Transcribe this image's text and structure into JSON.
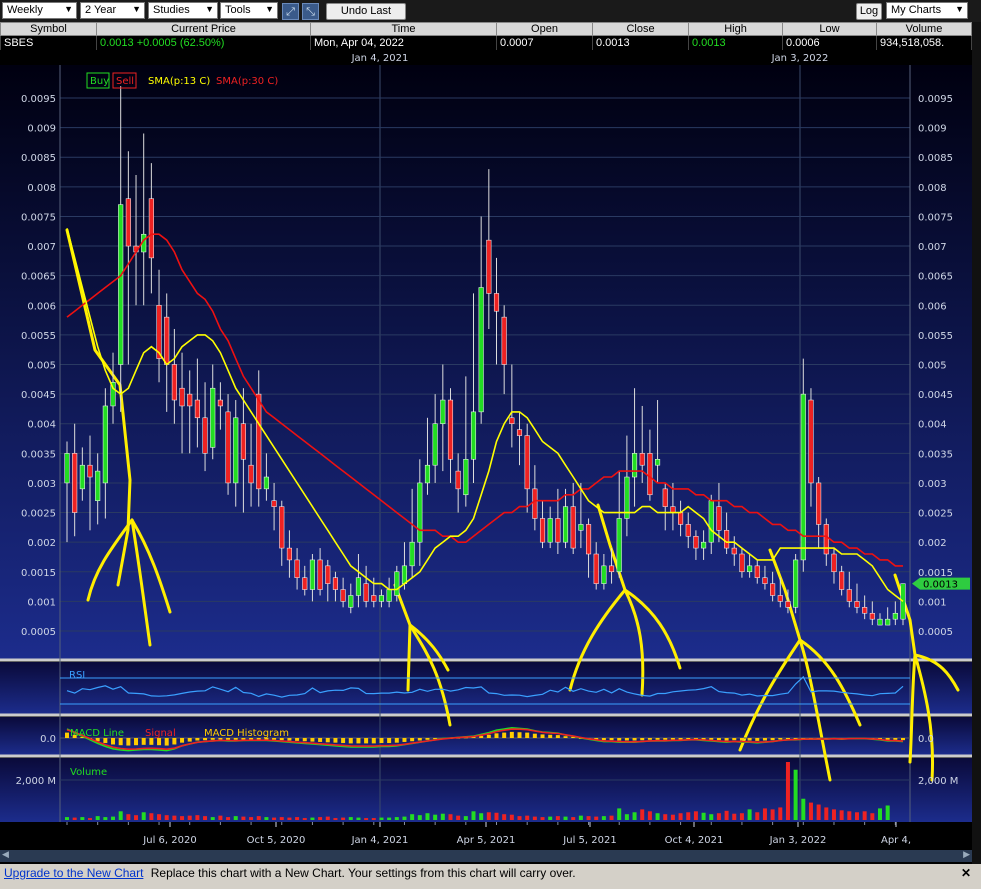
{
  "toolbar": {
    "interval": "Weekly",
    "range": "2 Year",
    "studies": "Studies",
    "tools": "Tools",
    "undo_label": "Undo Last",
    "log_label": "Log",
    "mycharts": "My Charts"
  },
  "quote": {
    "headers": [
      "Symbol",
      "Current Price",
      "Time",
      "Open",
      "Close",
      "High",
      "Low",
      "Volume"
    ],
    "symbol": "SBES",
    "current_price": "0.0013 +0.0005 (62.50%)",
    "time": "Mon, Apr 04, 2022",
    "open": "0.0007",
    "close": "0.0013",
    "high": "0.0013",
    "low": "0.0006",
    "volume": "934,518,058."
  },
  "status": {
    "link": "Upgrade to the New Chart",
    "message": "Replace this chart with a New Chart. Your settings from this chart will carry over."
  },
  "chart_data": {
    "type": "candlestick",
    "top_dates": [
      "Jan 4, 2021",
      "Jan 3, 2022"
    ],
    "x_labels": [
      "Jul 6, 2020",
      "Oct 5, 2020",
      "Jan 4, 2021",
      "Apr 5, 2021",
      "Jul 5, 2021",
      "Oct 4, 2021",
      "Jan 3, 2022",
      "Apr 4,"
    ],
    "y_ticks": [
      "0.0005",
      "0.001",
      "0.0015",
      "0.002",
      "0.0025",
      "0.003",
      "0.0035",
      "0.004",
      "0.0045",
      "0.005",
      "0.0055",
      "0.006",
      "0.0065",
      "0.007",
      "0.0075",
      "0.008",
      "0.0085",
      "0.009",
      "0.0095"
    ],
    "ylim": [
      0.0002,
      0.01
    ],
    "last_price_label": "0.0013",
    "legend": {
      "buy": "Buy",
      "sell": "Sell",
      "sma13": "SMA(p:13 C)",
      "sma30": "SMA(p:30 C)"
    },
    "colors": {
      "up": "#22dd22",
      "down": "#ee2222",
      "sma13": "#ffff00",
      "sma30": "#ee1111",
      "bg_top": "#000010",
      "bg_bottom": "#1c2c8c",
      "annotation": "#ffee00",
      "rsi": "#3aa0ff",
      "macd": "#22dd22",
      "signal": "#ee2222",
      "hist": "#ffcc00"
    },
    "candles": [
      [
        0.003,
        0.0035,
        0.0037,
        0.002
      ],
      [
        0.0035,
        0.0025,
        0.004,
        0.0021
      ],
      [
        0.0029,
        0.0033,
        0.0036,
        0.0027
      ],
      [
        0.0033,
        0.0031,
        0.0038,
        0.0022
      ],
      [
        0.0027,
        0.0032,
        0.0035,
        0.0023
      ],
      [
        0.003,
        0.0043,
        0.0046,
        0.0024
      ],
      [
        0.0043,
        0.0047,
        0.0052,
        0.004
      ],
      [
        0.005,
        0.0077,
        0.0097,
        0.0042
      ],
      [
        0.0078,
        0.007,
        0.0086,
        0.005
      ],
      [
        0.007,
        0.0069,
        0.0082,
        0.006
      ],
      [
        0.0069,
        0.0072,
        0.0089,
        0.006
      ],
      [
        0.0078,
        0.0068,
        0.0084,
        0.0062
      ],
      [
        0.006,
        0.0051,
        0.0066,
        0.0047
      ],
      [
        0.0058,
        0.005,
        0.0062,
        0.0042
      ],
      [
        0.005,
        0.0044,
        0.0056,
        0.004
      ],
      [
        0.0046,
        0.0043,
        0.0052,
        0.0035
      ],
      [
        0.0045,
        0.0043,
        0.0049,
        0.0035
      ],
      [
        0.0044,
        0.0041,
        0.0051,
        0.0036
      ],
      [
        0.0041,
        0.0035,
        0.0047,
        0.0032
      ],
      [
        0.0036,
        0.0046,
        0.005,
        0.0034
      ],
      [
        0.0044,
        0.0043,
        0.0047,
        0.0039
      ],
      [
        0.0042,
        0.003,
        0.0045,
        0.0028
      ],
      [
        0.003,
        0.0041,
        0.0044,
        0.0026
      ],
      [
        0.004,
        0.0034,
        0.0046,
        0.0025
      ],
      [
        0.0033,
        0.003,
        0.004,
        0.0026
      ],
      [
        0.0045,
        0.0029,
        0.0049,
        0.0026
      ],
      [
        0.0029,
        0.0031,
        0.0035,
        0.0027
      ],
      [
        0.0027,
        0.0026,
        0.003,
        0.0022
      ],
      [
        0.0026,
        0.0019,
        0.0027,
        0.0016
      ],
      [
        0.0019,
        0.0017,
        0.0022,
        0.0014
      ],
      [
        0.0017,
        0.0014,
        0.0019,
        0.0012
      ],
      [
        0.0014,
        0.0012,
        0.0016,
        0.0011
      ],
      [
        0.0012,
        0.0017,
        0.0018,
        0.001
      ],
      [
        0.0017,
        0.0012,
        0.0019,
        0.0011
      ],
      [
        0.0016,
        0.0013,
        0.0017,
        0.001
      ],
      [
        0.0014,
        0.0012,
        0.0015,
        0.001
      ],
      [
        0.0012,
        0.001,
        0.0014,
        0.0009
      ],
      [
        0.0009,
        0.0011,
        0.0013,
        0.0008
      ],
      [
        0.0011,
        0.0014,
        0.0018,
        0.0009
      ],
      [
        0.0013,
        0.001,
        0.0016,
        0.0009
      ],
      [
        0.0011,
        0.001,
        0.0014,
        0.0009
      ],
      [
        0.001,
        0.0011,
        0.0012,
        0.0009
      ],
      [
        0.001,
        0.0012,
        0.0014,
        0.0009
      ],
      [
        0.0011,
        0.0015,
        0.0016,
        0.001
      ],
      [
        0.0013,
        0.0016,
        0.002,
        0.0012
      ],
      [
        0.0016,
        0.002,
        0.0029,
        0.0014
      ],
      [
        0.002,
        0.003,
        0.0034,
        0.0016
      ],
      [
        0.003,
        0.0033,
        0.0041,
        0.0028
      ],
      [
        0.0033,
        0.004,
        0.0045,
        0.003
      ],
      [
        0.004,
        0.0044,
        0.005,
        0.0032
      ],
      [
        0.0044,
        0.0034,
        0.0046,
        0.003
      ],
      [
        0.0032,
        0.0029,
        0.0035,
        0.0025
      ],
      [
        0.0028,
        0.0034,
        0.0048,
        0.0026
      ],
      [
        0.0034,
        0.0042,
        0.0062,
        0.003
      ],
      [
        0.0042,
        0.0063,
        0.0075,
        0.004
      ],
      [
        0.0071,
        0.0062,
        0.0083,
        0.0056
      ],
      [
        0.0062,
        0.0059,
        0.0068,
        0.005
      ],
      [
        0.0058,
        0.005,
        0.006,
        0.0045
      ],
      [
        0.0041,
        0.004,
        0.005,
        0.0036
      ],
      [
        0.0039,
        0.0038,
        0.0042,
        0.0033
      ],
      [
        0.0038,
        0.0029,
        0.004,
        0.0025
      ],
      [
        0.0029,
        0.0024,
        0.0033,
        0.0022
      ],
      [
        0.0024,
        0.002,
        0.0027,
        0.0019
      ],
      [
        0.002,
        0.0024,
        0.0026,
        0.0019
      ],
      [
        0.0024,
        0.002,
        0.0029,
        0.0018
      ],
      [
        0.002,
        0.0026,
        0.0029,
        0.0019
      ],
      [
        0.0026,
        0.0019,
        0.003,
        0.0018
      ],
      [
        0.0022,
        0.0023,
        0.003,
        0.0019
      ],
      [
        0.0023,
        0.0018,
        0.0024,
        0.0014
      ],
      [
        0.0018,
        0.0013,
        0.002,
        0.0012
      ],
      [
        0.0013,
        0.0016,
        0.0018,
        0.0012
      ],
      [
        0.0016,
        0.0015,
        0.0019,
        0.0013
      ],
      [
        0.0015,
        0.0024,
        0.0032,
        0.0014
      ],
      [
        0.0024,
        0.0031,
        0.0038,
        0.0021
      ],
      [
        0.0031,
        0.0035,
        0.0046,
        0.0026
      ],
      [
        0.0035,
        0.0033,
        0.0043,
        0.003
      ],
      [
        0.0035,
        0.0028,
        0.0039,
        0.0027
      ],
      [
        0.0033,
        0.0034,
        0.0044,
        0.003
      ],
      [
        0.0029,
        0.0026,
        0.003,
        0.0022
      ],
      [
        0.0026,
        0.0025,
        0.003,
        0.0022
      ],
      [
        0.0025,
        0.0023,
        0.0027,
        0.0021
      ],
      [
        0.0023,
        0.0021,
        0.0025,
        0.0019
      ],
      [
        0.0021,
        0.0019,
        0.0022,
        0.0017
      ],
      [
        0.0019,
        0.002,
        0.0022,
        0.0017
      ],
      [
        0.002,
        0.0027,
        0.0028,
        0.0018
      ],
      [
        0.0026,
        0.0022,
        0.003,
        0.002
      ],
      [
        0.0022,
        0.0019,
        0.0025,
        0.0018
      ],
      [
        0.0019,
        0.0018,
        0.0021,
        0.0016
      ],
      [
        0.0018,
        0.0015,
        0.0019,
        0.0014
      ],
      [
        0.0015,
        0.0016,
        0.0018,
        0.0014
      ],
      [
        0.0016,
        0.0014,
        0.0017,
        0.0013
      ],
      [
        0.0014,
        0.0013,
        0.0016,
        0.0012
      ],
      [
        0.0013,
        0.0011,
        0.0015,
        0.001
      ],
      [
        0.0011,
        0.001,
        0.0014,
        0.0009
      ],
      [
        0.001,
        0.0009,
        0.0012,
        0.0008
      ],
      [
        0.0009,
        0.0017,
        0.0018,
        0.0008
      ],
      [
        0.0017,
        0.0045,
        0.0051,
        0.0015
      ],
      [
        0.0044,
        0.003,
        0.0046,
        0.0026
      ],
      [
        0.003,
        0.0023,
        0.0031,
        0.0019
      ],
      [
        0.0023,
        0.0018,
        0.0024,
        0.0016
      ],
      [
        0.0018,
        0.0015,
        0.0019,
        0.0013
      ],
      [
        0.0015,
        0.0012,
        0.0016,
        0.0011
      ],
      [
        0.0012,
        0.001,
        0.0015,
        0.0009
      ],
      [
        0.001,
        0.0009,
        0.0013,
        0.0008
      ],
      [
        0.0009,
        0.0008,
        0.0011,
        0.0007
      ],
      [
        0.0008,
        0.0007,
        0.001,
        0.0006
      ],
      [
        0.0006,
        0.0007,
        0.0008,
        0.0006
      ],
      [
        0.0006,
        0.0007,
        0.0009,
        0.0006
      ],
      [
        0.0007,
        0.0008,
        0.001,
        0.0006
      ],
      [
        0.0007,
        0.0013,
        0.0013,
        0.0006
      ]
    ],
    "sma13": [
      0.0073,
      0.0068,
      0.0063,
      0.0058,
      0.0053,
      0.0049,
      0.0046,
      0.0045,
      0.0046,
      0.0049,
      0.0052,
      0.0053,
      0.0052,
      0.005,
      0.0051,
      0.0053,
      0.0054,
      0.0055,
      0.0055,
      0.0054,
      0.0052,
      0.0049,
      0.0046,
      0.0044,
      0.0042,
      0.004,
      0.0038,
      0.0036,
      0.0034,
      0.0032,
      0.003,
      0.0028,
      0.0026,
      0.0024,
      0.0022,
      0.002,
      0.0018,
      0.0016,
      0.0015,
      0.0014,
      0.0013,
      0.0013,
      0.0012,
      0.0012,
      0.0013,
      0.0014,
      0.0015,
      0.0017,
      0.0019,
      0.002,
      0.0021,
      0.0021,
      0.0022,
      0.0024,
      0.0028,
      0.0032,
      0.0037,
      0.004,
      0.0042,
      0.0042,
      0.0041,
      0.0039,
      0.0037,
      0.0036,
      0.0035,
      0.0033,
      0.0031,
      0.0029,
      0.0027,
      0.0026,
      0.0025,
      0.0025,
      0.0025,
      0.0025,
      0.0025,
      0.0026,
      0.0026,
      0.0025,
      0.0025,
      0.0025,
      0.0025,
      0.0026,
      0.0025,
      0.0024,
      0.0022,
      0.0021,
      0.002,
      0.002,
      0.0019,
      0.0018,
      0.0017,
      0.0017,
      0.0017,
      0.0019,
      0.0019,
      0.0019,
      0.0019,
      0.0019,
      0.0019,
      0.0019,
      0.0019,
      0.0018,
      0.0018,
      0.0018,
      0.0017,
      0.0016,
      0.0014,
      0.0012,
      0.0011,
      0.001
    ],
    "sma30": [
      0.0058,
      0.0059,
      0.006,
      0.0061,
      0.0062,
      0.0063,
      0.0064,
      0.0065,
      0.0067,
      0.0069,
      0.0071,
      0.0072,
      0.0072,
      0.0071,
      0.0069,
      0.0066,
      0.0064,
      0.0062,
      0.0061,
      0.0059,
      0.0056,
      0.0054,
      0.0051,
      0.0048,
      0.0046,
      0.0044,
      0.0042,
      0.0041,
      0.004,
      0.0039,
      0.0038,
      0.0037,
      0.0036,
      0.0035,
      0.0034,
      0.0033,
      0.0032,
      0.0031,
      0.003,
      0.0029,
      0.0028,
      0.0027,
      0.0026,
      0.0025,
      0.0024,
      0.0023,
      0.0022,
      0.0022,
      0.0022,
      0.0021,
      0.0021,
      0.002,
      0.002,
      0.0021,
      0.0022,
      0.0023,
      0.0024,
      0.0025,
      0.0025,
      0.0026,
      0.0026,
      0.0027,
      0.0027,
      0.0027,
      0.0027,
      0.0028,
      0.0028,
      0.0029,
      0.0029,
      0.003,
      0.0031,
      0.0031,
      0.0032,
      0.0032,
      0.0032,
      0.0032,
      0.0031,
      0.003,
      0.003,
      0.0029,
      0.0029,
      0.0029,
      0.0028,
      0.0028,
      0.0027,
      0.0027,
      0.0027,
      0.0026,
      0.0026,
      0.0025,
      0.0025,
      0.0024,
      0.0023,
      0.0023,
      0.0022,
      0.0022,
      0.0021,
      0.0021,
      0.0021,
      0.0021,
      0.002,
      0.002,
      0.0019,
      0.0019,
      0.0018,
      0.0018,
      0.0017,
      0.0017,
      0.0016,
      0.0016
    ],
    "rsi": {
      "label": "RSI"
    },
    "macd": {
      "label": "MACD Line",
      "signal_label": "Signal",
      "hist_label": "MACD Histogram",
      "tick": "0.0"
    },
    "volume": {
      "label": "Volume",
      "tick": "2,000 M",
      "values": [
        30,
        25,
        30,
        20,
        40,
        30,
        35,
        90,
        60,
        50,
        80,
        70,
        60,
        50,
        45,
        40,
        45,
        50,
        40,
        30,
        45,
        30,
        40,
        35,
        30,
        40,
        30,
        25,
        30,
        25,
        30,
        20,
        25,
        30,
        35,
        20,
        25,
        30,
        25,
        20,
        20,
        25,
        25,
        30,
        35,
        60,
        50,
        70,
        55,
        65,
        60,
        45,
        40,
        90,
        70,
        80,
        75,
        60,
        55,
        40,
        45,
        35,
        30,
        35,
        40,
        35,
        30,
        45,
        40,
        35,
        40,
        45,
        120,
        60,
        80,
        110,
        90,
        70,
        60,
        55,
        70,
        80,
        90,
        75,
        60,
        70,
        95,
        65,
        70,
        110,
        80,
        120,
        110,
        130,
        600,
        520,
        220,
        180,
        160,
        130,
        110,
        100,
        90,
        80,
        90,
        70,
        120,
        150
      ]
    }
  }
}
